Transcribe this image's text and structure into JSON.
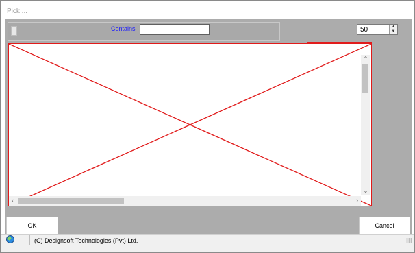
{
  "window": {
    "title": "Pick ..."
  },
  "filter": {
    "contains_label": "Contains",
    "contains_value": ""
  },
  "count": {
    "value": "50"
  },
  "buttons": {
    "ok_label": "OK",
    "cancel_label": "Cancel"
  },
  "status": {
    "text": "(C) Designsoft Technologies (Pvt) Ltd."
  },
  "colors": {
    "accent_red": "#e11b1b",
    "label_blue": "#1a1aff",
    "panel_gray": "#acacac"
  },
  "icons": {
    "status": "globe-icon",
    "grip": "size-grip-icon"
  }
}
